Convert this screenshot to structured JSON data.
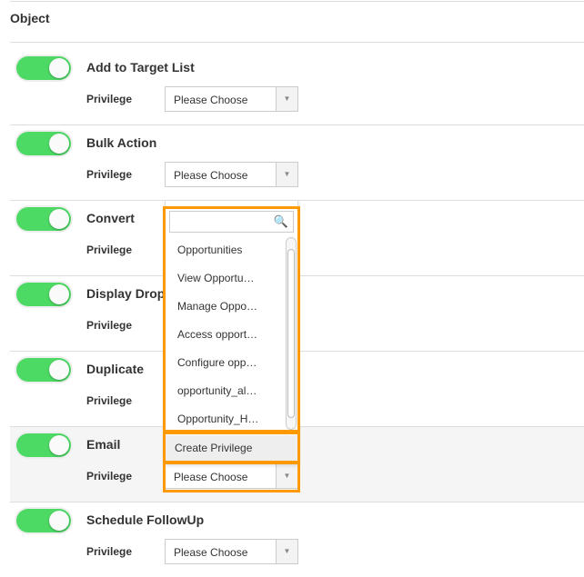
{
  "section_title": "Object",
  "privilege_label": "Privilege",
  "select_placeholder": "Please Choose",
  "rows": [
    {
      "name": "Add to Target List",
      "enabled": true
    },
    {
      "name": "Bulk Action",
      "enabled": true
    },
    {
      "name": "Convert",
      "enabled": true
    },
    {
      "name": "Display Drop",
      "enabled": true
    },
    {
      "name": "Duplicate",
      "enabled": true
    },
    {
      "name": "Email",
      "enabled": true
    },
    {
      "name": "Schedule FollowUp",
      "enabled": true
    }
  ],
  "dropdown": {
    "search_placeholder": "",
    "items": [
      "Opportunities",
      "View Opportu…",
      "Manage Oppo…",
      "Access opport…",
      "Configure opp…",
      "opportunity_al…",
      "Opportunity_H…"
    ],
    "create_label": "Create Privilege"
  },
  "colors": {
    "toggle_on": "#4cd964",
    "highlight": "#ff9900"
  }
}
